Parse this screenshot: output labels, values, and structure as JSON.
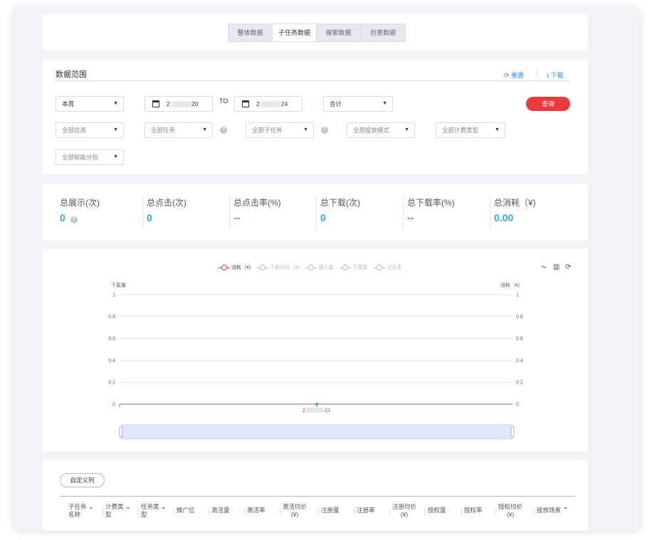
{
  "tabs": [
    "整体数据",
    "子任务数据",
    "搜索数据",
    "创意数据"
  ],
  "filter": {
    "title": "数据范围",
    "reset": "重置",
    "download": "下载",
    "period": "本周",
    "date_start_prefix": "2",
    "date_start_suffix": "20",
    "to": "TO",
    "date_end_prefix": "2",
    "date_end_suffix": "24",
    "aggregate": "合计",
    "query": "查询",
    "app": "全部应用",
    "task": "全部任务",
    "subtask": "全部子任务",
    "delivery_mode": "全部投放模式",
    "billing_type": "全部计费类型",
    "smart_package": "全部智能分包"
  },
  "stats": [
    {
      "label": "总展示(次)",
      "value": "0"
    },
    {
      "label": "总点击(次)",
      "value": "0"
    },
    {
      "label": "总点击率(%)",
      "value": "--"
    },
    {
      "label": "总下载(次)",
      "value": "0"
    },
    {
      "label": "总下载率(%)",
      "value": "--"
    },
    {
      "label": "总消耗（¥)",
      "value": "0.00"
    }
  ],
  "chart_data": {
    "type": "line",
    "legend": [
      {
        "name": "消耗（¥)",
        "active": true
      },
      {
        "name": "下载均价（¥)",
        "active": false
      },
      {
        "name": "展示量",
        "active": false
      },
      {
        "name": "下载率",
        "active": false
      },
      {
        "name": "点击率",
        "active": false
      }
    ],
    "ylabel_left": "下载量",
    "ylabel_right": "消耗（¥)",
    "yticks": [
      "0",
      "0.2",
      "0.4",
      "0.6",
      "0.8",
      "1"
    ],
    "ylim": [
      0,
      1
    ],
    "x_prefix": "2",
    "x_suffix": "-21",
    "series": [
      {
        "name": "消耗（¥)",
        "values": [
          0
        ]
      }
    ],
    "colors": {
      "active_series": "#e03b3b",
      "point": "#3fb39b",
      "zoom_fill": "#dfe8fb"
    }
  },
  "table": {
    "customize": "自定义列",
    "headers": [
      {
        "text": "子任务\n名称",
        "arrow": true
      },
      {
        "text": "计费类\n型",
        "arrow": true
      },
      {
        "text": "任务类\n型",
        "arrow": true
      },
      {
        "text": "推广位",
        "arrow": false
      },
      {
        "text": "激活量",
        "arrow": false
      },
      {
        "text": "激活率",
        "arrow": false
      },
      {
        "text": "激活均价\n(¥)",
        "arrow": false
      },
      {
        "text": "注册量",
        "arrow": false
      },
      {
        "text": "注册率",
        "arrow": false
      },
      {
        "text": "注册均价\n(¥)",
        "arrow": false
      },
      {
        "text": "授权量",
        "arrow": false
      },
      {
        "text": "授权率",
        "arrow": false
      },
      {
        "text": "授权均价\n(¥)",
        "arrow": false
      },
      {
        "text": "投放场景",
        "arrow": true
      }
    ]
  }
}
